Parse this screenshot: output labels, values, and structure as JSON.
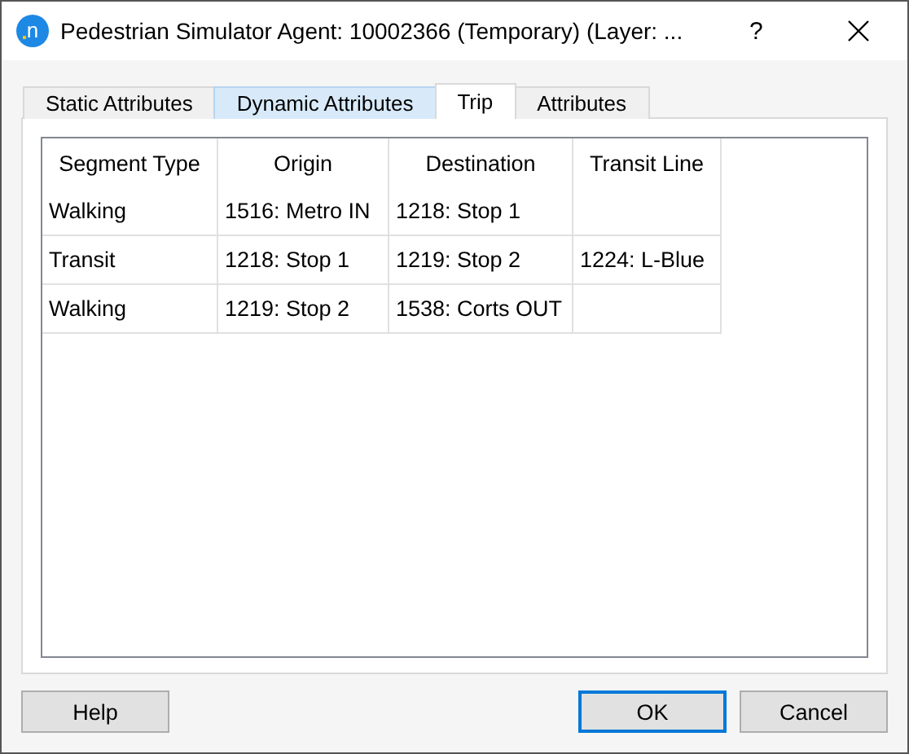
{
  "window": {
    "logo_letter": "n",
    "title": "Pedestrian Simulator Agent: 10002366 (Temporary) (Layer: ...",
    "help_glyph": "?"
  },
  "tabs": [
    {
      "label": "Static Attributes",
      "selected": false,
      "hovered": false
    },
    {
      "label": "Dynamic Attributes",
      "selected": false,
      "hovered": true
    },
    {
      "label": "Trip",
      "selected": true,
      "hovered": false
    },
    {
      "label": "Attributes",
      "selected": false,
      "hovered": false
    }
  ],
  "table": {
    "columns": [
      "Segment Type",
      "Origin",
      "Destination",
      "Transit Line"
    ],
    "rows": [
      [
        "Walking",
        "1516: Metro IN",
        "1218: Stop 1",
        ""
      ],
      [
        "Transit",
        "1218: Stop 1",
        "1219: Stop 2",
        "1224: L-Blue"
      ],
      [
        "Walking",
        "1219: Stop 2",
        "1538: Corts OUT",
        ""
      ]
    ]
  },
  "buttons": [
    {
      "label": "Help",
      "default": false
    },
    {
      "label": "OK",
      "default": true
    },
    {
      "label": "Cancel",
      "default": false
    }
  ]
}
